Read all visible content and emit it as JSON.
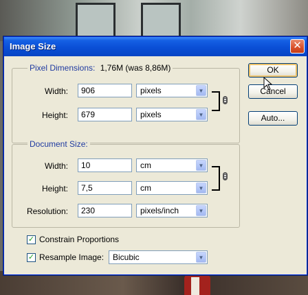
{
  "window": {
    "title": "Image Size"
  },
  "pixel_dimensions": {
    "label": "Pixel Dimensions:",
    "size_text": "1,76M (was 8,86M)",
    "width_label": "Width:",
    "width_value": "906",
    "width_unit": "pixels",
    "height_label": "Height:",
    "height_value": "679",
    "height_unit": "pixels"
  },
  "document_size": {
    "label": "Document Size:",
    "width_label": "Width:",
    "width_value": "10",
    "width_unit": "cm",
    "height_label": "Height:",
    "height_value": "7,5",
    "height_unit": "cm",
    "resolution_label": "Resolution:",
    "resolution_value": "230",
    "resolution_unit": "pixels/inch"
  },
  "options": {
    "constrain_label": "Constrain Proportions",
    "constrain_checked": true,
    "resample_label": "Resample Image:",
    "resample_checked": true,
    "resample_method": "Bicubic"
  },
  "buttons": {
    "ok": "OK",
    "cancel": "Cancel",
    "auto": "Auto..."
  },
  "icons": {
    "close": "close-icon",
    "chain": "chain-link-icon",
    "dropdown": "chevron-down-icon",
    "cursor": "mouse-pointer-icon"
  },
  "colors": {
    "titlebar": "#0a4fd6",
    "group_label": "#1f3aa0",
    "dialog_bg": "#ece9d8"
  }
}
